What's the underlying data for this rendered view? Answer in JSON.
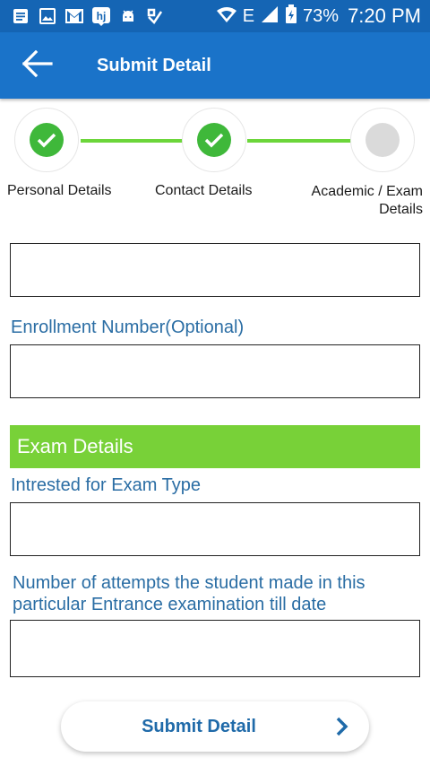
{
  "status_bar": {
    "battery": "73%",
    "time": "7:20 PM",
    "network": "E",
    "icons": [
      "document-icon",
      "image-icon",
      "gmail-icon",
      "hj-app-icon",
      "android-icon",
      "check-app-icon",
      "wifi-icon",
      "signal-icon",
      "battery-icon"
    ]
  },
  "app_bar": {
    "title": "Submit Detail",
    "back_icon": "arrow-left-icon"
  },
  "stepper": {
    "steps": [
      {
        "label": "Personal Details",
        "status": "done"
      },
      {
        "label": "Contact Details",
        "status": "done"
      },
      {
        "label": "Academic / Exam Details",
        "status": "pending"
      }
    ],
    "done_color": "#3fb83a",
    "connector_color": "#6cd63a"
  },
  "form": {
    "enrollment_label": "Enrollment Number(Optional)",
    "section_title": "Exam Details",
    "exam_type_label": "Intrested for Exam Type",
    "attempts_label": "Number of attempts the student made in this particular Entrance examination till date"
  },
  "submit": {
    "label": "Submit Detail",
    "icon": "chevron-right-icon"
  },
  "colors": {
    "status_bar": "#1565b4",
    "app_bar": "#1a73c9",
    "section_bar": "#78d138",
    "label_text": "#2a6da4"
  }
}
